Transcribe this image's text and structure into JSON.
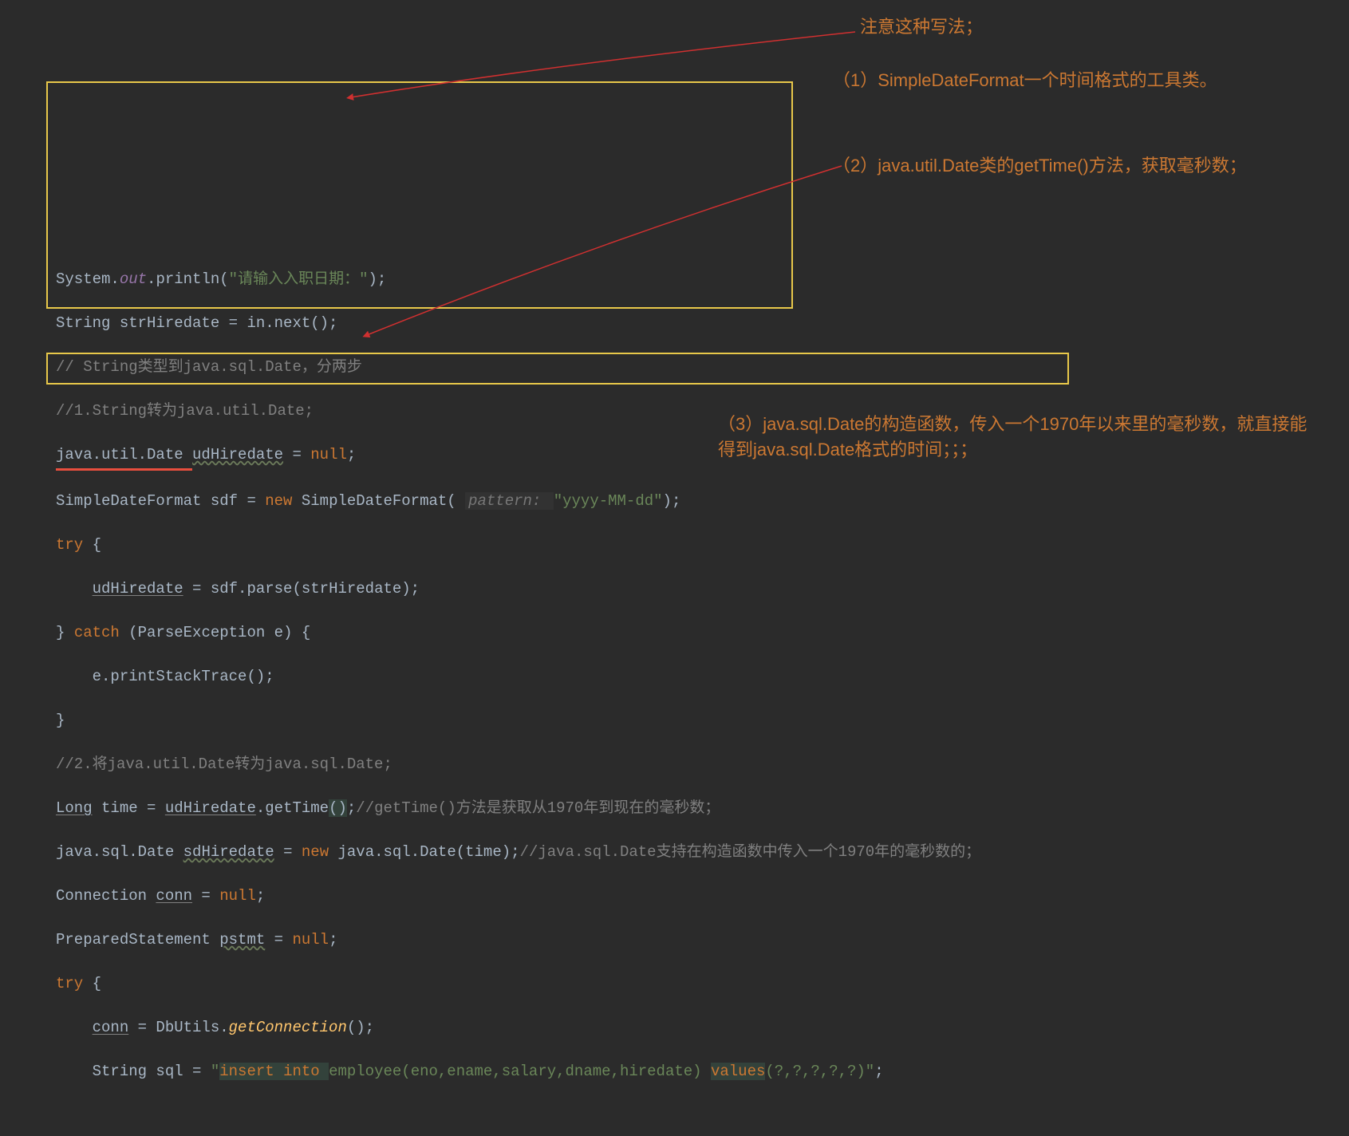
{
  "code": {
    "l1": {
      "a": "System.",
      "b": "out",
      "c": ".println(",
      "d": "\"请输入入职日期：\"",
      "e": ");"
    },
    "l2": {
      "a": "String strHiredate = in.next();"
    },
    "l3": {
      "a": "// String类型到java.sql.Date，分两步"
    },
    "l4": {
      "a": "//1.String转为java.util.Date;"
    },
    "l5": {
      "a": "java.util.Date ",
      "b": "udHiredate",
      "c": " = ",
      "d": "null",
      "e": ";"
    },
    "l6": {
      "a": "SimpleDateFormat sdf = ",
      "b": "new ",
      "c": "SimpleDateFormat( ",
      "d": "pattern: ",
      "e": "\"yyyy-MM-dd\"",
      "f": ");"
    },
    "l7": {
      "a": "try ",
      "b": "{"
    },
    "l8": {
      "a": "    ",
      "b": "udHiredate",
      "c": " = sdf.parse(strHiredate);"
    },
    "l9": {
      "a": "} ",
      "b": "catch ",
      "c": "(ParseException e) {"
    },
    "l10": {
      "a": "    e.printStackTrace();"
    },
    "l11": {
      "a": "}"
    },
    "l12": {
      "a": "//2.将java.util.Date转为java.sql.Date;"
    },
    "l13": {
      "a": "Long",
      " ": "",
      "b": " time = ",
      "c": "udHiredate",
      "d": ".getTime",
      "e": "()",
      "f": ";",
      "g": "//getTime()方法是获取从1970年到现在的毫秒数；"
    },
    "l14": {
      "a": "java.sql.Date ",
      "b": "sdHiredate",
      "c": " = ",
      "d": "new ",
      "e": "java.sql.Date(time);",
      "f": "//java.sql.Date支持在构造函数中传入一个1970年的毫秒数的；"
    },
    "l15": {
      "a": "Connection ",
      "b": "conn",
      "c": " = ",
      "d": "null",
      "e": ";"
    },
    "l16": {
      "a": "PreparedStatement ",
      "b": "pstmt",
      "c": " = ",
      "d": "null",
      "e": ";"
    },
    "l17": {
      "a": "try ",
      "b": "{"
    },
    "l18": {
      "a": "    ",
      "b": "conn",
      "c": " = DbUtils.",
      "d": "getConnection",
      "e": "();"
    },
    "l19": {
      "a": "    String sql = ",
      "b": "\"",
      "c": "insert into ",
      "d": "employee(eno,ename,salary,dname,hiredate) ",
      "e": "values",
      "f": "(?,?,?,?,?)\"",
      "g": ";"
    }
  },
  "annot": {
    "note0": "注意这种写法；",
    "note1a": "（1）SimpleDateFormat一个时间格式的工具类。",
    "note2a": "（2）java.util.Date类的getTime()方法，获取毫秒数；",
    "note3a": "（3）java.sql.Date的构造函数，传入一个1970年以来里的毫秒数，就直接能得到java.sql.Date格式的时间；；；"
  }
}
